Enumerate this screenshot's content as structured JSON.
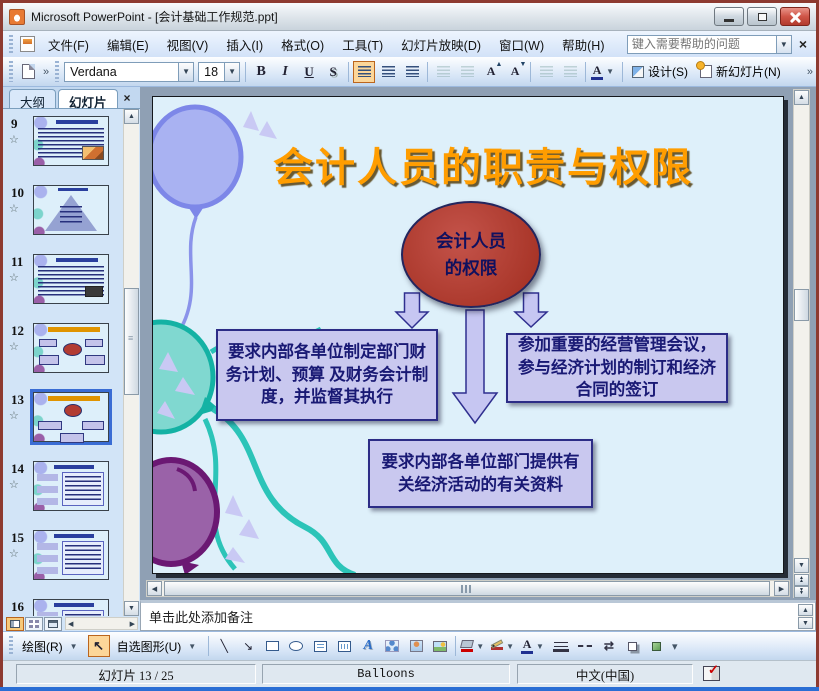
{
  "window": {
    "title": "Microsoft PowerPoint - [会计基础工作规范.ppt]"
  },
  "menubar": {
    "items": [
      "文件(F)",
      "编辑(E)",
      "视图(V)",
      "插入(I)",
      "格式(O)",
      "工具(T)",
      "幻灯片放映(D)",
      "窗口(W)",
      "帮助(H)"
    ],
    "help_box_placeholder": "键入需要帮助的问题",
    "close_label": "×"
  },
  "format_toolbar": {
    "font_name": "Verdana",
    "font_size": "18",
    "bold_label": "B",
    "italic_label": "I",
    "underline_label": "U",
    "shadow_label": "S",
    "design_label": "设计(S)",
    "new_slide_label": "新幻灯片(N)"
  },
  "sidebar": {
    "outline_tab": "大纲",
    "slides_tab": "幻灯片",
    "close_label": "×",
    "thumbnails": [
      {
        "num": "9",
        "kind": "textpic",
        "selected": false
      },
      {
        "num": "10",
        "kind": "pyramid",
        "selected": false
      },
      {
        "num": "11",
        "kind": "textpic2",
        "selected": false
      },
      {
        "num": "12",
        "kind": "diagram4",
        "selected": false
      },
      {
        "num": "13",
        "kind": "diagram3",
        "selected": true
      },
      {
        "num": "14",
        "kind": "arrows",
        "selected": false
      },
      {
        "num": "15",
        "kind": "arrows",
        "selected": false
      },
      {
        "num": "16",
        "kind": "arrows",
        "selected": false
      }
    ]
  },
  "slide": {
    "title": "会计人员的职责与权限",
    "ellipse": {
      "line1": "会计人员",
      "line2": "的权限"
    },
    "box_left": "要求内部各单位制定部门财务计划、预算 及财务会计制度，并监督其执行",
    "box_right": "参加重要的经营管理会议，参与经济计划的制订和经济合同的签订",
    "box_bottom": "要求内部各单位部门提供有关经济活动的有关资料"
  },
  "notes": {
    "placeholder": "单击此处添加备注"
  },
  "drawing_toolbar": {
    "draw_label": "绘图(R)",
    "autoshapes_label": "自选图形(U)"
  },
  "statusbar": {
    "slide_position": "幻灯片 13 / 25",
    "design_template": "Balloons",
    "language": "中文(中国)"
  },
  "icons": {
    "anim_star_glyph": "☆"
  },
  "colors": {
    "slide_title": "#ff9d00",
    "ellipse_fill": "#b23c32",
    "box_fill": "#c9c8ef",
    "box_border": "#2c2c86",
    "fill_color_swatch": "#cc0000",
    "line_color_swatch": "#b03030",
    "font_color_swatch": "#203090"
  }
}
